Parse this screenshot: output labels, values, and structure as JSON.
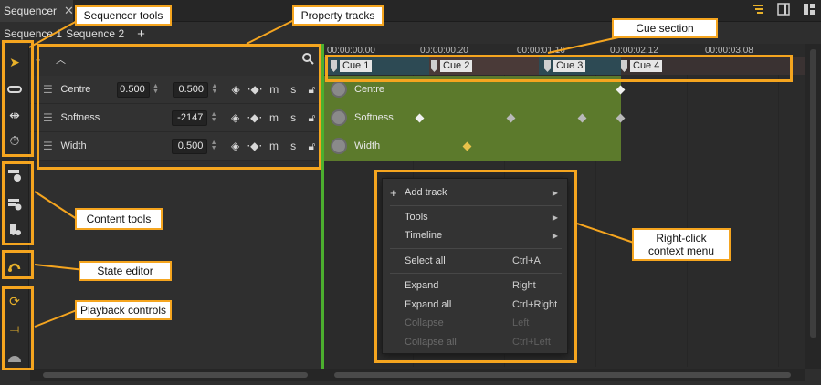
{
  "window": {
    "tab_title": "Sequencer",
    "close_glyph": "✕"
  },
  "sequences": {
    "tab1": "Sequence 1",
    "tab2": "Sequence 2",
    "add_glyph": "+"
  },
  "ruler": [
    "00:00:00.00",
    "00:00:00.20",
    "00:00:01.16",
    "00:00:02.12",
    "00:00:03.08"
  ],
  "cues": [
    "Cue 1",
    "Cue 2",
    "Cue 3",
    "Cue 4"
  ],
  "tracks": [
    {
      "name": "Centre",
      "value1": "0.500",
      "value2": "0.500"
    },
    {
      "name": "Softness",
      "value1": "",
      "value2": "-2147"
    },
    {
      "name": "Width",
      "value1": "0.500",
      "value2": "0.500"
    }
  ],
  "track_buttons": {
    "m": "m",
    "s": "s"
  },
  "context_menu": {
    "add_track": "Add track",
    "tools": "Tools",
    "timeline": "Timeline",
    "select_all": "Select all",
    "select_all_sc": "Ctrl+A",
    "expand": "Expand",
    "expand_sc": "Right",
    "expand_all": "Expand all",
    "expand_all_sc": "Ctrl+Right",
    "collapse": "Collapse",
    "collapse_sc": "Left",
    "collapse_all": "Collapse all",
    "collapse_all_sc": "Ctrl+Left"
  },
  "annotations": {
    "sequencer_tools": "Sequencer tools",
    "property_tracks": "Property tracks",
    "cue_section": "Cue section",
    "content_tools": "Content tools",
    "state_editor": "State editor",
    "playback_controls": "Playback controls",
    "context_menu": "Right-click context menu"
  },
  "colors": {
    "accent": "#f5a51f",
    "track_green": "#5c7a2c",
    "playhead": "#4caf2f"
  },
  "icons": [
    "select-arrow-icon",
    "link-icon",
    "fit-width-icon",
    "timer-icon",
    "add-content-icon",
    "add-content-settings-icon",
    "content-delete-icon",
    "state-editor-icon",
    "loop-icon",
    "step-icon",
    "speed-icon",
    "search-icon",
    "lock-icon",
    "keyframe-icon"
  ]
}
